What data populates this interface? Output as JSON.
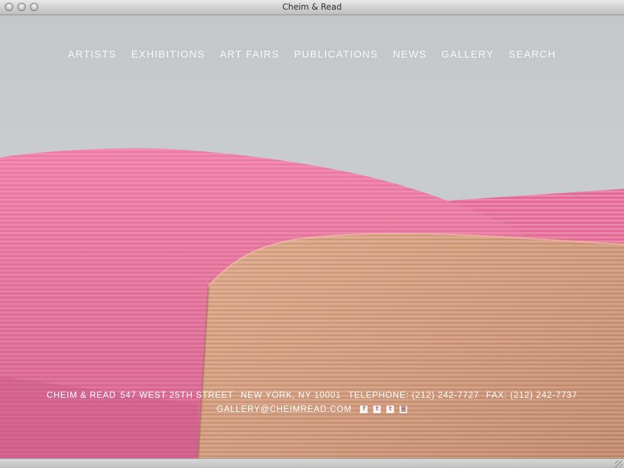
{
  "window": {
    "title": "Cheim & Read"
  },
  "nav": {
    "items": [
      "ARTISTS",
      "EXHIBITIONS",
      "ART FAIRS",
      "PUBLICATIONS",
      "NEWS",
      "GALLERY",
      "SEARCH"
    ]
  },
  "footer": {
    "name": "CHEIM & READ",
    "street": "547 WEST 25TH STREET",
    "city": "NEW YORK, NY 10001",
    "telephone": "TELEPHONE: (212) 242-7727",
    "fax": "FAX: (212) 242-7737",
    "email": "GALLERY@CHEIMREAD.COM",
    "social": [
      {
        "icon": "facebook-icon",
        "glyph": "f"
      },
      {
        "icon": "twitter-icon",
        "glyph": "t"
      },
      {
        "icon": "tumblr-icon",
        "glyph": "t"
      },
      {
        "icon": "instagram-icon",
        "glyph": "◙"
      }
    ]
  },
  "colors": {
    "pink": "#e86e98",
    "tan": "#d8a082",
    "wall": "#c8cbcc"
  }
}
